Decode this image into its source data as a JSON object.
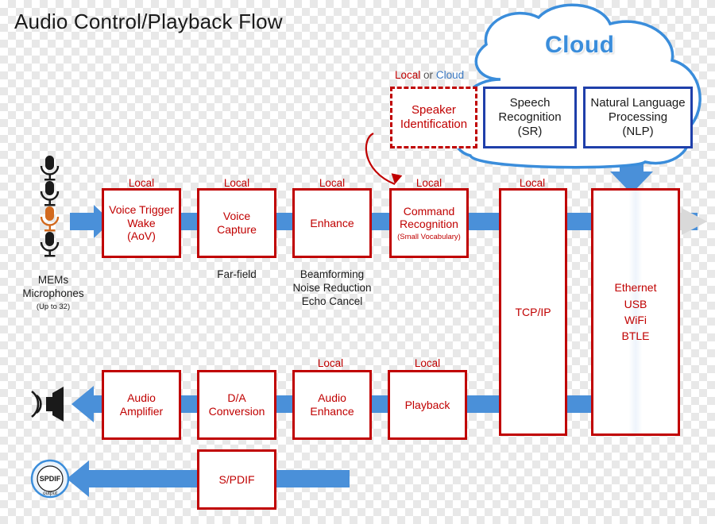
{
  "title": "Audio Control/Playback Flow",
  "cloud": {
    "label": "Cloud"
  },
  "local_or_cloud": {
    "local": "Local",
    "or": "or",
    "cloud": "Cloud"
  },
  "top_blocks": [
    {
      "name": "speaker-identification",
      "label": "Speaker\nIdentification",
      "style": "dashed-red"
    },
    {
      "name": "speech-recognition",
      "label": "Speech\nRecognition\n(SR)",
      "style": "blue"
    },
    {
      "name": "natural-language-processing",
      "label": "Natural Language\nProcessing\n(NLP)",
      "style": "blue"
    }
  ],
  "capture_chain": {
    "labels": [
      "Local",
      "Local",
      "Local",
      "Local",
      "Local"
    ],
    "blocks": [
      {
        "name": "voice-trigger-wake",
        "line1": "Voice Trigger",
        "line2": "Wake",
        "line3": "(AoV)"
      },
      {
        "name": "voice-capture",
        "line1": "Voice",
        "line2": "Capture"
      },
      {
        "name": "enhance",
        "line1": "Enhance"
      },
      {
        "name": "command-recognition",
        "line1": "Command",
        "line2": "Recognition",
        "small": "(Small Vocabulary)"
      }
    ],
    "captions": [
      "Far-field",
      "Beamforming\nNoise Reduction\nEcho Cancel"
    ]
  },
  "transport": {
    "label": "Local",
    "tcpip": "TCP/IP",
    "interfaces": [
      "Ethernet",
      "USB",
      "WiFi",
      "BTLE"
    ]
  },
  "playback_chain": {
    "labels": [
      "Local",
      "Local"
    ],
    "blocks": [
      {
        "name": "audio-amplifier",
        "line1": "Audio",
        "line2": "Amplifier"
      },
      {
        "name": "da-conversion",
        "line1": "D/A",
        "line2": "Conversion"
      },
      {
        "name": "audio-enhance",
        "line1": "Audio",
        "line2": "Enhance"
      },
      {
        "name": "playback",
        "line1": "Playback"
      }
    ]
  },
  "spdif": {
    "block_label": "S/PDIF",
    "badge_line1": "SPDIF",
    "badge_line2": "output"
  },
  "mems": {
    "line1": "MEMs",
    "line2": "Microphones",
    "line3": "(Up to 32)",
    "mic_count": 4
  },
  "colors": {
    "red": "#c00000",
    "blue_box": "#1f3faa",
    "arrow_blue": "#4a90d9",
    "cloud_blue": "#3a8ddb",
    "grey_arrow": "#d9d9d9"
  }
}
